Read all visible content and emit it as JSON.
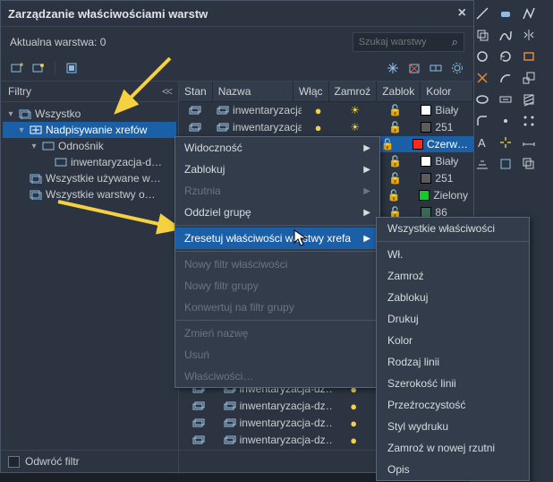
{
  "dialog": {
    "title": "Zarządzanie właściwościami warstw",
    "current_layer_label": "Aktualna warstwa: 0",
    "search_placeholder": "Szukaj warstwy",
    "filters_label": "Filtry",
    "collapse_label": "<<",
    "invert_filter_label": "Odwróć filtr"
  },
  "tree": {
    "root": "Wszystko",
    "n1": "Nadpisywanie xrefów",
    "n2": "Odnośnik",
    "n3": "inwentaryzacja-d…",
    "n4": "Wszystkie używane w…",
    "n5": "Wszystkie warstwy o…"
  },
  "grid": {
    "headers": {
      "stan": "Stan",
      "nazwa": "Nazwa",
      "wlacz": "Włąc",
      "zamroz": "Zamroź",
      "zablok": "Zablok",
      "kolor": "Kolor"
    },
    "rows": [
      {
        "name": "inwentaryzacja-dz…",
        "color": "Biały",
        "swatch": "#ffffff",
        "sel": false
      },
      {
        "name": "inwentaryzacja-dz…",
        "color": "251",
        "swatch": "#5b5b5b",
        "sel": false
      },
      {
        "name": "inwentaryzacja-dz…",
        "color": "Czerw…",
        "swatch": "#ff2a1a",
        "sel": true
      },
      {
        "name": "inwentaryzacja-dz…",
        "color": "Biały",
        "swatch": "#ffffff",
        "sel": false
      },
      {
        "name": "inwentaryzacja-dz…",
        "color": "251",
        "swatch": "#5b5b5b",
        "sel": false
      },
      {
        "name": "inwentaryzacja-dz…",
        "color": "Zielony",
        "swatch": "#16c72e",
        "sel": false
      },
      {
        "name": "inwentaryzacja-dz…",
        "color": "86",
        "swatch": "#3a6b56",
        "sel": false
      }
    ],
    "rows_below": [
      {
        "name": "inwentaryzacja-dz…"
      },
      {
        "name": "inwentaryzacja-dz…"
      },
      {
        "name": "inwentaryzacja-dz…"
      },
      {
        "name": "inwentaryzacja-dz…"
      }
    ]
  },
  "ctx": {
    "widocznosc": "Widoczność",
    "zablokuj": "Zablokuj",
    "rzutnia": "Rzutnia",
    "oddziel": "Oddziel grupę",
    "zresetuj": "Zresetuj właściwości warstwy xrefa",
    "nowy_filtr_wl": "Nowy filtr właściwości",
    "nowy_filtr_gr": "Nowy filtr grupy",
    "konwertuj": "Konwertuj na filtr grupy",
    "zmien": "Zmień nazwę",
    "usun": "Usuń",
    "wlasciwosci": "Właściwości…"
  },
  "sub": {
    "wszystkie": "Wszystkie właściwości",
    "wl": "Wł.",
    "zamroz": "Zamroź",
    "zablokuj": "Zablokuj",
    "drukuj": "Drukuj",
    "kolor": "Kolor",
    "rodzaj": "Rodzaj linii",
    "szer": "Szerokość linii",
    "przez": "Przeźroczystość",
    "styl": "Styl wydruku",
    "zamroz_rz": "Zamroź w nowej rzutni",
    "opis": "Opis"
  }
}
